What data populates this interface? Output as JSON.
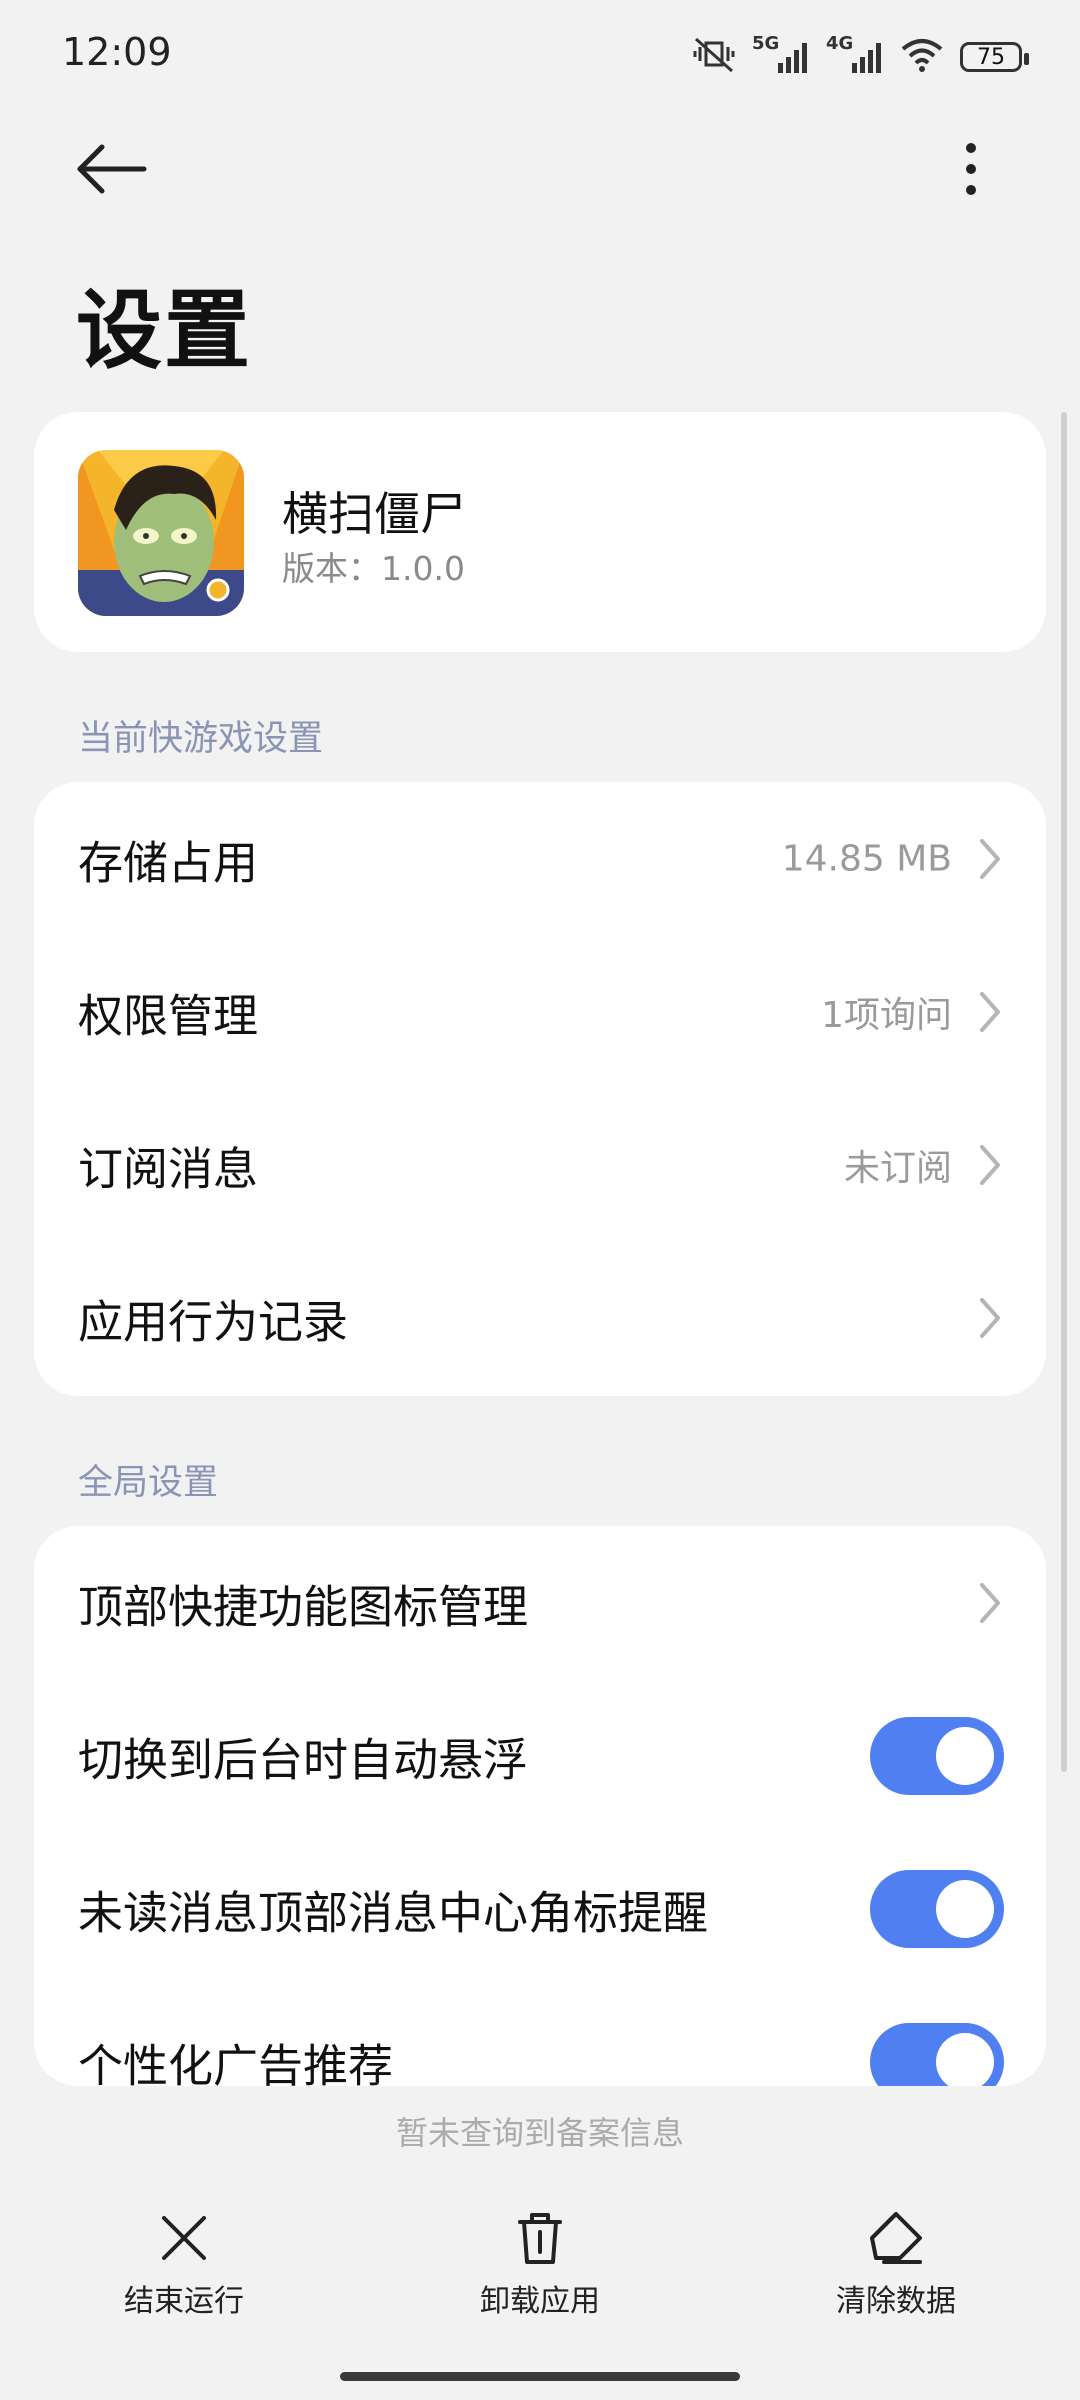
{
  "status_bar": {
    "time": "12:09",
    "signal_1_label": "5G",
    "signal_2_label": "4G",
    "battery": "75"
  },
  "header": {
    "back_icon": "arrow-left-icon",
    "more_icon": "more-vertical-icon",
    "title": "设置"
  },
  "app": {
    "name": "横扫僵尸",
    "version": "版本：1.0.0"
  },
  "section_current": {
    "label": "当前快游戏设置",
    "items": [
      {
        "title": "存储占用",
        "value": "14.85 MB"
      },
      {
        "title": "权限管理",
        "value": "1项询问"
      },
      {
        "title": "订阅消息",
        "value": "未订阅"
      },
      {
        "title": "应用行为记录",
        "value": ""
      }
    ]
  },
  "section_global": {
    "label": "全局设置",
    "items": [
      {
        "title": "顶部快捷功能图标管理"
      },
      {
        "title": "切换到后台时自动悬浮",
        "enabled": true
      },
      {
        "title": "未读消息顶部消息中心角标提醒",
        "enabled": true
      },
      {
        "title": "个性化广告推荐",
        "enabled": true
      }
    ]
  },
  "record_info": "暂未查询到备案信息",
  "actions": {
    "stop": "结束运行",
    "uninstall": "卸载应用",
    "clear": "清除数据"
  },
  "colors": {
    "accent": "#4f7ff0",
    "section_label": "#8a95b6",
    "background": "#f2f2f2"
  }
}
